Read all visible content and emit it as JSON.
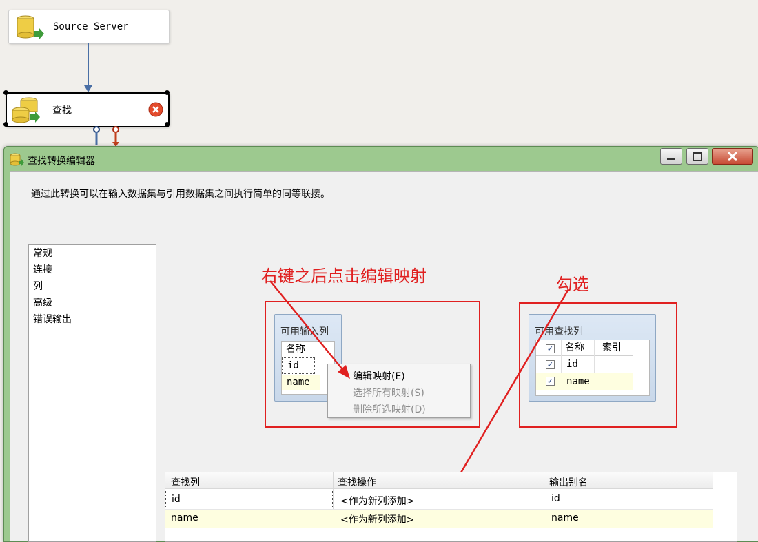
{
  "canvas": {
    "source_node": {
      "title": "Source_Server"
    },
    "lookup_node": {
      "title": "查找"
    }
  },
  "dialog": {
    "title": "查找转换编辑器",
    "description": "通过此转换可以在输入数据集与引用数据集之间执行简单的同等联接。",
    "nav_items": [
      "常规",
      "连接",
      "列",
      "高级",
      "错误输出"
    ],
    "input_columns": {
      "header": "可用输入列",
      "col_header": "名称",
      "rows": [
        "id",
        "name"
      ]
    },
    "lookup_columns": {
      "header": "可用查找列",
      "col_name": "名称",
      "col_index": "索引",
      "rows": [
        {
          "name": "id",
          "checked": true
        },
        {
          "name": "name",
          "checked": true
        }
      ]
    },
    "context_menu": {
      "items": [
        {
          "label": "编辑映射(E)",
          "enabled": true
        },
        {
          "label": "选择所有映射(S)",
          "enabled": false
        },
        {
          "label": "删除所选映射(D)",
          "enabled": false
        }
      ]
    },
    "grid": {
      "headers": [
        "查找列",
        "查找操作",
        "输出别名"
      ],
      "rows": [
        [
          "id",
          "<作为新列添加>",
          "id"
        ],
        [
          "name",
          "<作为新列添加>",
          "name"
        ]
      ]
    }
  },
  "annotations": {
    "right_click": "右键之后点击编辑映射",
    "check": "勾选"
  },
  "colors": {
    "annotation_red": "#e02020",
    "dialog_frame": "#9dc98f"
  }
}
